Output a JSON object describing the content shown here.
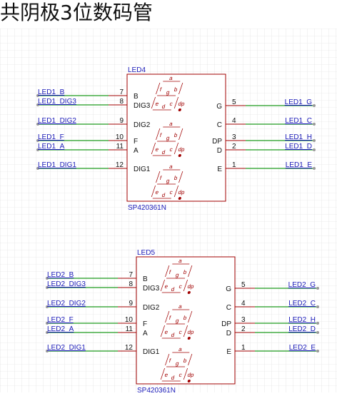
{
  "title": "共阴极3位数码管",
  "colors": {
    "net_label": "#1a1ab8",
    "wire": "#1f9a1f",
    "pin_line": "#a00000",
    "body": "#a00000",
    "pin_text": "#111111",
    "grid": "#dcdcdc",
    "seg_text": "#a00000"
  },
  "components": [
    {
      "ref": "LED4",
      "part": "SP420361N",
      "left_pins": [
        {
          "num": "7",
          "name": "B",
          "net": "LED1_B"
        },
        {
          "num": "8",
          "name": "DIG3",
          "net": "LED1_DIG3"
        },
        {
          "num": "9",
          "name": "DIG2",
          "net": "LED1_DIG2"
        },
        {
          "num": "10",
          "name": "F",
          "net": "LED1_F"
        },
        {
          "num": "11",
          "name": "A",
          "net": "LED1_A"
        },
        {
          "num": "12",
          "name": "DIG1",
          "net": "LED1_DIG1"
        }
      ],
      "right_pins": [
        {
          "num": "5",
          "name": "G",
          "net": "LED1_G"
        },
        {
          "num": "4",
          "name": "C",
          "net": "LED1_C"
        },
        {
          "num": "3",
          "name": "DP",
          "net": "LED1_H"
        },
        {
          "num": "2",
          "name": "D",
          "net": "LED1_D"
        },
        {
          "num": "1",
          "name": "E",
          "net": "LED1_E"
        }
      ]
    },
    {
      "ref": "LED5",
      "part": "SP420361N",
      "left_pins": [
        {
          "num": "7",
          "name": "B",
          "net": "LED2_B"
        },
        {
          "num": "8",
          "name": "DIG3",
          "net": "LED2_DIG3"
        },
        {
          "num": "9",
          "name": "DIG2",
          "net": "LED2_DIG2"
        },
        {
          "num": "10",
          "name": "F",
          "net": "LED2_F"
        },
        {
          "num": "11",
          "name": "A",
          "net": "LED2_A"
        },
        {
          "num": "12",
          "name": "DIG1",
          "net": "LED2_DIG1"
        }
      ],
      "right_pins": [
        {
          "num": "5",
          "name": "G",
          "net": "LED2_G"
        },
        {
          "num": "4",
          "name": "C",
          "net": "LED2_C"
        },
        {
          "num": "3",
          "name": "DP",
          "net": "LED2_H"
        },
        {
          "num": "2",
          "name": "D",
          "net": "LED2_D"
        },
        {
          "num": "1",
          "name": "E",
          "net": "LED2_E"
        }
      ]
    }
  ],
  "segment_glyph": {
    "a": "a",
    "b": "b",
    "c": "c",
    "d": "d",
    "e": "e",
    "f": "f",
    "g": "g",
    "dp": "dp"
  }
}
